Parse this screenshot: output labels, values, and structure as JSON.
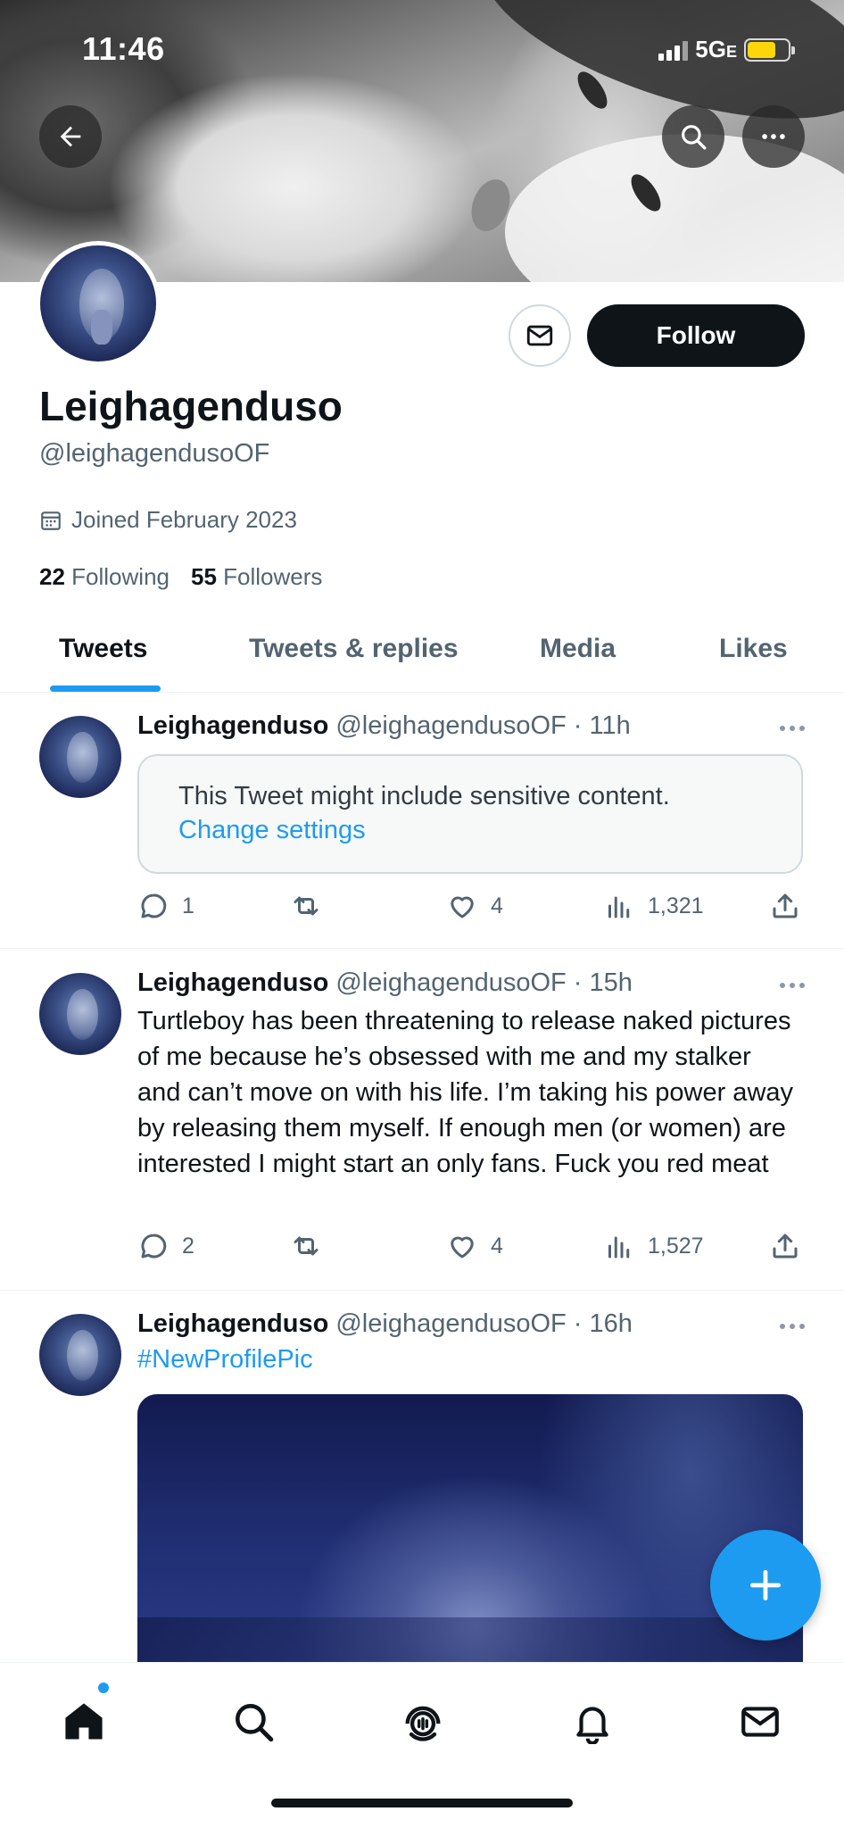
{
  "status_bar": {
    "time": "11:46",
    "network": "5G",
    "network_suffix": "E"
  },
  "profile": {
    "display_name": "Leighagenduso",
    "handle": "@leighagendusoOF",
    "joined": "Joined February 2023",
    "following_count": "22",
    "following_label": "Following",
    "followers_count": "55",
    "followers_label": "Followers",
    "follow_label": "Follow"
  },
  "tabs": [
    {
      "label": "Tweets",
      "active": true
    },
    {
      "label": "Tweets & replies",
      "active": false
    },
    {
      "label": "Media",
      "active": false
    },
    {
      "label": "Likes",
      "active": false
    }
  ],
  "tweets": [
    {
      "name": "Leighagenduso",
      "meta": "@leighagendusoOF · 11h",
      "sensitive_message": "This Tweet might include sensitive content.",
      "sensitive_link": "Change settings",
      "replies": "1",
      "retweets": "",
      "likes": "4",
      "views": "1,321"
    },
    {
      "name": "Leighagenduso",
      "meta": "@leighagendusoOF · 15h",
      "text": "Turtleboy has been threatening to release naked pictures of me because he’s obsessed with me and my stalker and can’t move on with his life. I’m taking his power away by releasing them myself. If enough men (or women) are interested I might start an only fans. Fuck you red meat",
      "replies": "2",
      "retweets": "",
      "likes": "4",
      "views": "1,527"
    },
    {
      "name": "Leighagenduso",
      "meta": "@leighagendusoOF · 16h",
      "hashtag": "#NewProfilePic"
    }
  ],
  "colors": {
    "accent": "#1d9bf0",
    "text": "#0f1419",
    "secondary": "#536471"
  },
  "icons": [
    "back-arrow-icon",
    "search-icon",
    "more-icon",
    "mail-icon",
    "calendar-icon",
    "reply-icon",
    "retweet-icon",
    "like-icon",
    "views-icon",
    "share-icon",
    "compose-icon",
    "home-icon",
    "spaces-icon",
    "bell-icon"
  ]
}
